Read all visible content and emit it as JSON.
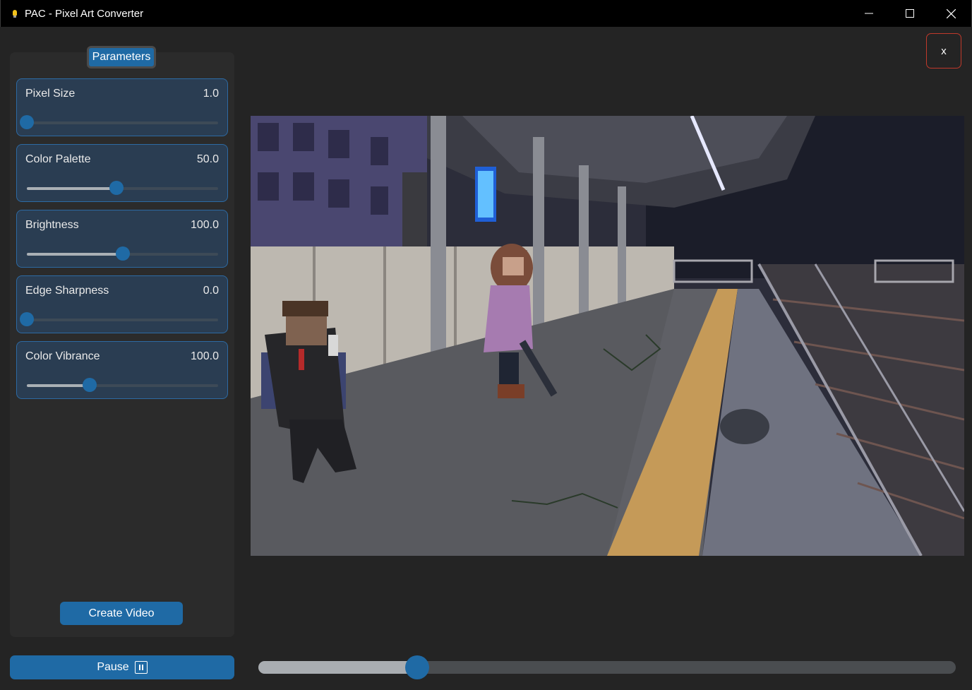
{
  "window": {
    "title": "PAC - Pixel Art Converter"
  },
  "sidebar": {
    "tab_label": "Parameters",
    "params": [
      {
        "label": "Pixel Size",
        "value": "1.0",
        "fraction": 0.0
      },
      {
        "label": "Color Palette",
        "value": "50.0",
        "fraction": 0.47
      },
      {
        "label": "Brightness",
        "value": "100.0",
        "fraction": 0.5
      },
      {
        "label": "Edge Sharpness",
        "value": "0.0",
        "fraction": 0.0
      },
      {
        "label": "Color Vibrance",
        "value": "100.0",
        "fraction": 0.33
      }
    ],
    "create_video_label": "Create Video"
  },
  "controls": {
    "pause_label": "Pause",
    "close_label": "x"
  },
  "timeline": {
    "progress": 0.228
  },
  "colors": {
    "accent": "#1f6aa5",
    "card_bg": "#2a3d52",
    "close_border": "#c0392b"
  },
  "icons": {
    "app": "lightbulb-icon",
    "minimize": "minimize-icon",
    "maximize": "maximize-icon",
    "close": "close-icon",
    "pause": "pause-icon"
  }
}
